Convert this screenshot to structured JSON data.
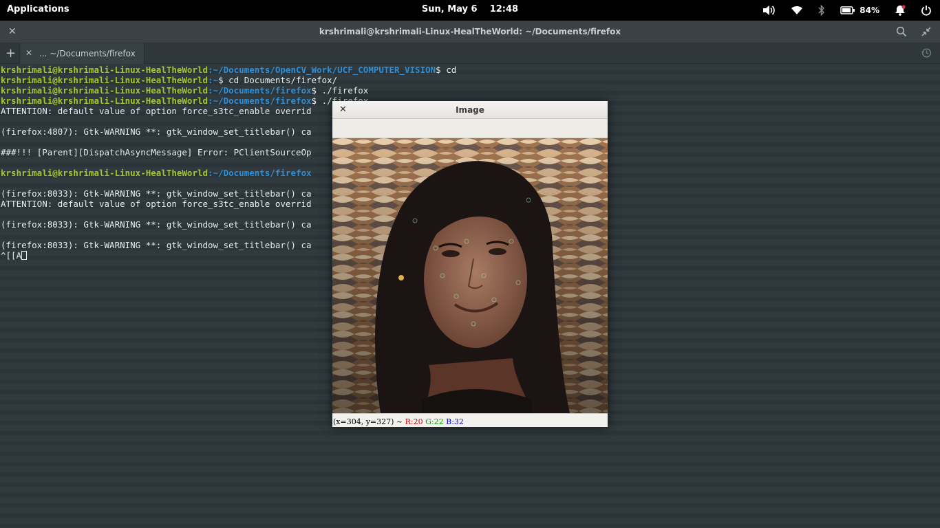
{
  "panel": {
    "applications": "Applications",
    "date": "Sun, May  6",
    "time": "12:48",
    "battery_percent": "84%"
  },
  "terminal": {
    "title": "krshrimali@krshrimali-Linux-HealTheWorld: ~/Documents/firefox",
    "tab_label": "... ~/Documents/firefox",
    "lines": [
      {
        "user": "krshrimali@krshrimali-Linux-HealTheWorld",
        "path": ":~/Documents/OpenCV_Work/UCF_COMPUTER_VISION",
        "text": "$ cd"
      },
      {
        "user": "krshrimali@krshrimali-Linux-HealTheWorld",
        "path": ":~",
        "text": "$ cd Documents/firefox/"
      },
      {
        "user": "krshrimali@krshrimali-Linux-HealTheWorld",
        "path": ":~/Documents/firefox",
        "text": "$ ./firefox"
      },
      {
        "user": "krshrimali@krshrimali-Linux-HealTheWorld",
        "path": ":~/Documents/firefox",
        "text": "$ ./firefox"
      },
      {
        "text": "ATTENTION: default value of option force_s3tc_enable overrid"
      },
      {
        "text": ""
      },
      {
        "text": "(firefox:4807): Gtk-WARNING **: gtk_window_set_titlebar() ca"
      },
      {
        "text": ""
      },
      {
        "text": "###!!! [Parent][DispatchAsyncMessage] Error: PClientSourceOp                                            own actor ID"
      },
      {
        "text": ""
      },
      {
        "user": "krshrimali@krshrimali-Linux-HealTheWorld",
        "path": ":~/Documents/firefox",
        "text": ""
      },
      {
        "text": ""
      },
      {
        "text": "(firefox:8033): Gtk-WARNING **: gtk_window_set_titlebar() ca"
      },
      {
        "text": "ATTENTION: default value of option force_s3tc_enable overrid"
      },
      {
        "text": ""
      },
      {
        "text": "(firefox:8033): Gtk-WARNING **: gtk_window_set_titlebar() ca"
      },
      {
        "text": ""
      },
      {
        "text": "(firefox:8033): Gtk-WARNING **: gtk_window_set_titlebar() ca"
      },
      {
        "text": "^[[A",
        "cursor": true
      }
    ]
  },
  "image_window": {
    "title": "Image",
    "status_pos": "(x=304, y=327) ~ ",
    "status_r": "R:20",
    "status_g": "G:22",
    "status_b": "B:32"
  },
  "colors": {
    "terminal_bg": "#2b3438",
    "prompt_user": "#a8c52c",
    "prompt_path": "#2d8fd8",
    "panel_bg": "#000000"
  }
}
